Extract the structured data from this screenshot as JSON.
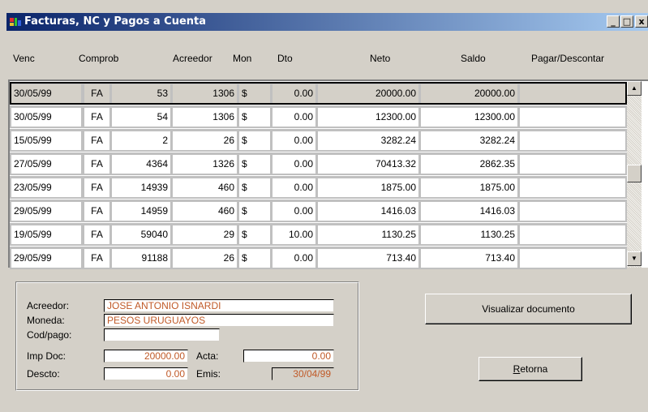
{
  "window": {
    "title": "Facturas, NC y Pagos a Cuenta",
    "controls": {
      "minimize": "_",
      "maximize": "□",
      "close": "x"
    },
    "title_gradient": [
      "#0a246a",
      "#a6caf0"
    ]
  },
  "grid": {
    "columns": [
      "Venc",
      "Comprob",
      "Acreedor",
      "Mon",
      "Dto",
      "Neto",
      "Saldo",
      "Pagar/Descontar"
    ],
    "rows": [
      {
        "venc": "30/05/99",
        "tipo": "FA",
        "numero": "53",
        "acreedor": "1306",
        "mon": "$",
        "dto": "0.00",
        "neto": "20000.00",
        "saldo": "20000.00",
        "pagar": ""
      },
      {
        "venc": "30/05/99",
        "tipo": "FA",
        "numero": "54",
        "acreedor": "1306",
        "mon": "$",
        "dto": "0.00",
        "neto": "12300.00",
        "saldo": "12300.00",
        "pagar": ""
      },
      {
        "venc": "15/05/99",
        "tipo": "FA",
        "numero": "2",
        "acreedor": "26",
        "mon": "$",
        "dto": "0.00",
        "neto": "3282.24",
        "saldo": "3282.24",
        "pagar": ""
      },
      {
        "venc": "27/05/99",
        "tipo": "FA",
        "numero": "4364",
        "acreedor": "1326",
        "mon": "$",
        "dto": "0.00",
        "neto": "70413.32",
        "saldo": "2862.35",
        "pagar": ""
      },
      {
        "venc": "23/05/99",
        "tipo": "FA",
        "numero": "14939",
        "acreedor": "460",
        "mon": "$",
        "dto": "0.00",
        "neto": "1875.00",
        "saldo": "1875.00",
        "pagar": ""
      },
      {
        "venc": "29/05/99",
        "tipo": "FA",
        "numero": "14959",
        "acreedor": "460",
        "mon": "$",
        "dto": "0.00",
        "neto": "1416.03",
        "saldo": "1416.03",
        "pagar": ""
      },
      {
        "venc": "19/05/99",
        "tipo": "FA",
        "numero": "59040",
        "acreedor": "29",
        "mon": "$",
        "dto": "10.00",
        "neto": "1130.25",
        "saldo": "1130.25",
        "pagar": ""
      },
      {
        "venc": "29/05/99",
        "tipo": "FA",
        "numero": "91188",
        "acreedor": "26",
        "mon": "$",
        "dto": "0.00",
        "neto": "713.40",
        "saldo": "713.40",
        "pagar": ""
      }
    ],
    "scrollbar": {
      "up": "▲",
      "down": "▼"
    }
  },
  "details": {
    "acreedor_label": "Acreedor:",
    "acreedor_value": "JOSE ANTONIO ISNARDI",
    "moneda_label": "Moneda:",
    "moneda_value": "PESOS URUGUAYOS",
    "codpago_label": "Cod/pago:",
    "codpago_value": "",
    "impdoc_label": "Imp Doc:",
    "impdoc_value": "20000.00",
    "acta_label": "Acta:",
    "acta_value": "0.00",
    "descto_label": "Descto:",
    "descto_value": "0.00",
    "emis_label": "Emis:",
    "emis_value": "30/04/99",
    "value_color": "#c05a28"
  },
  "buttons": {
    "visualizar": "Visualizar documento",
    "retorna_accel": "R",
    "retorna_rest": "etorna"
  }
}
